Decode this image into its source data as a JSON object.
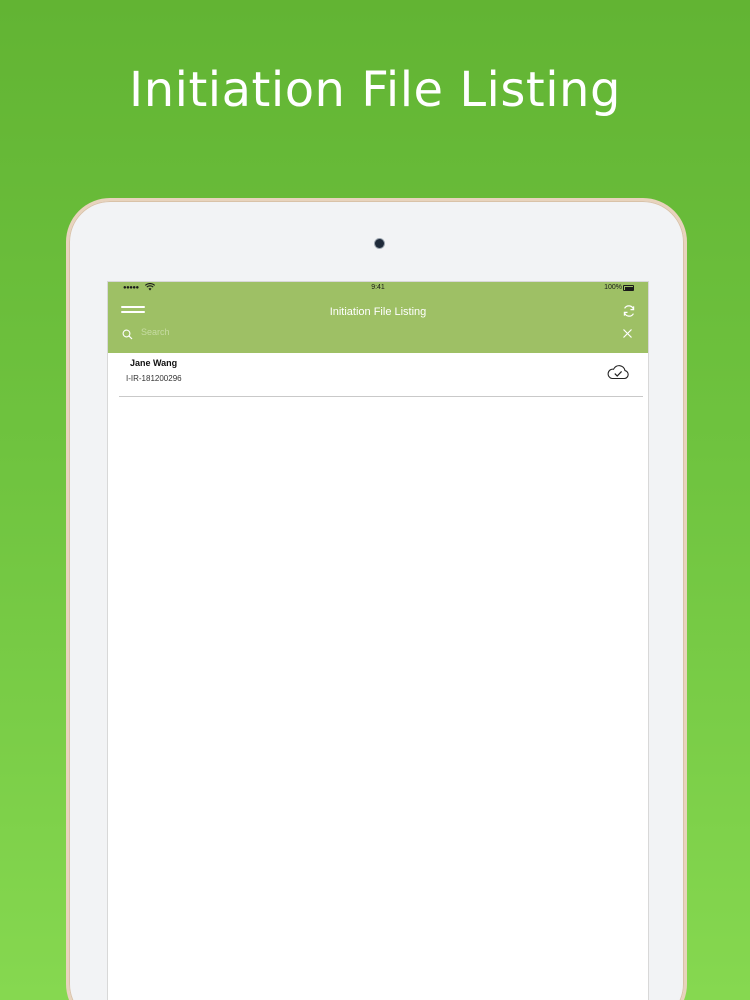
{
  "promo": {
    "title": "Initiation File Listing"
  },
  "status_bar": {
    "signal": "●●●●●",
    "time": "9:41",
    "battery": "100%"
  },
  "app_bar": {
    "title": "Initiation File Listing",
    "menu_icon": "hamburger-icon",
    "refresh_icon": "refresh-icon"
  },
  "search": {
    "placeholder": "Search",
    "value": "",
    "clear_icon": "close-icon"
  },
  "files": [
    {
      "name": "Jane Wang",
      "id": "I-IR-181200296",
      "status_icon": "cloud-check-icon"
    }
  ],
  "colors": {
    "background_top": "#62b433",
    "background_bottom": "#86d850",
    "app_bar": "#9ec065",
    "divider": "#c9c9c9"
  }
}
